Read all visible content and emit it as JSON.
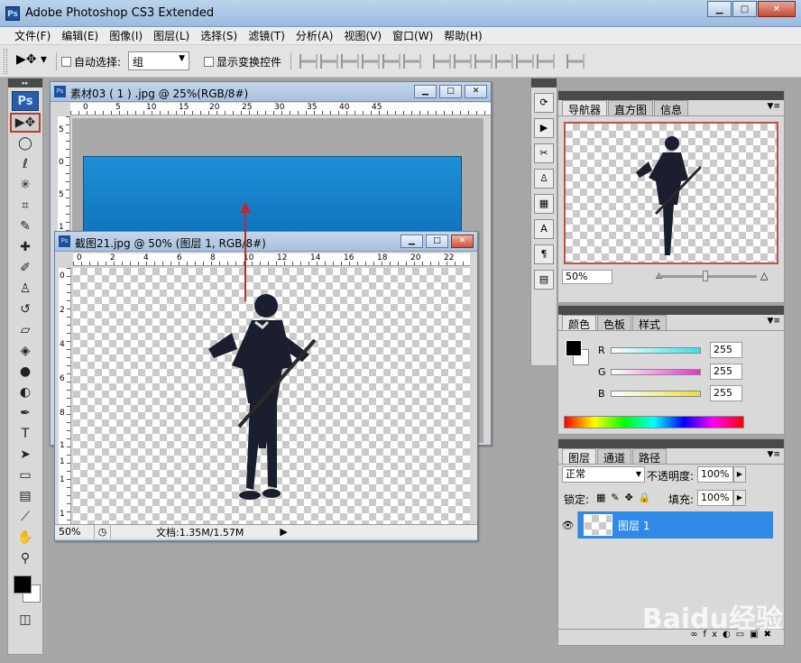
{
  "app": {
    "title": "Adobe Photoshop CS3 Extended",
    "icon_text": "Ps"
  },
  "window_controls": {
    "minimize": "▁",
    "maximize": "□",
    "close": "✕"
  },
  "menu": [
    "文件(F)",
    "编辑(E)",
    "图像(I)",
    "图层(L)",
    "选择(S)",
    "滤镜(T)",
    "分析(A)",
    "视图(V)",
    "窗口(W)",
    "帮助(H)"
  ],
  "options_bar": {
    "auto_select_label": "自动选择:",
    "auto_select_value": "组",
    "show_transform_label": "显示变换控件"
  },
  "toolbox": {
    "logo": "Ps"
  },
  "doc1": {
    "title": "素材03 ( 1 ) .jpg @ 25%(RGB/8#)",
    "ruler_h": [
      "0",
      "5",
      "10",
      "15",
      "20",
      "25",
      "30",
      "35",
      "40",
      "45"
    ],
    "ruler_v": [
      "5",
      "0",
      "5",
      "1"
    ]
  },
  "doc2": {
    "title": "截图21.jpg @ 50% (图层 1, RGB/8#)",
    "ruler_h": [
      "0",
      "2",
      "4",
      "6",
      "8",
      "10",
      "12",
      "14",
      "16",
      "18",
      "20",
      "22"
    ],
    "ruler_v": [
      "0",
      "2",
      "4",
      "6",
      "8",
      "1",
      "1",
      "1",
      "1"
    ],
    "zoom": "50%",
    "doc_info": "文档:1.35M/1.57M"
  },
  "navigator": {
    "tabs": [
      "导航器",
      "直方图",
      "信息"
    ],
    "zoom": "50%"
  },
  "color_panel": {
    "tabs": [
      "颜色",
      "色板",
      "样式"
    ],
    "channels": [
      {
        "label": "R",
        "value": "255",
        "color": "#36e0e8"
      },
      {
        "label": "G",
        "value": "255",
        "color": "#e035c8"
      },
      {
        "label": "B",
        "value": "255",
        "color": "#e8e035"
      }
    ]
  },
  "layers_panel": {
    "tabs": [
      "图层",
      "通道",
      "路径"
    ],
    "blend_mode": "正常",
    "opacity_label": "不透明度:",
    "opacity_value": "100%",
    "lock_label": "锁定:",
    "fill_label": "填充:",
    "fill_value": "100%",
    "layer_name": "图层 1"
  },
  "watermark": "Baidu经验"
}
